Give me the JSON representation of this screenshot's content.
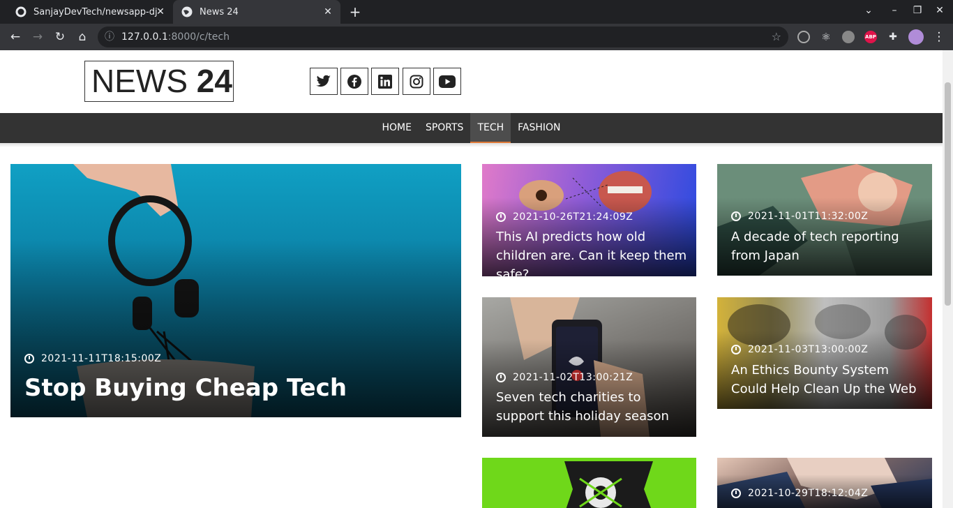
{
  "browser": {
    "tabs": [
      {
        "title": "SanjayDevTech/newsapp-djan",
        "favicon": "github-icon"
      },
      {
        "title": "News 24",
        "favicon": "globe-icon"
      }
    ],
    "url_host": "127.0.0.1",
    "url_path": ":8000/c/tech",
    "extensions": [
      "radio-icon",
      "react-icon",
      "gecko-icon",
      "abp-icon",
      "puzzle-icon",
      "avatar-icon"
    ],
    "abp_label": "ABP"
  },
  "site": {
    "logo_light": "NEWS ",
    "logo_bold": "24",
    "social": [
      "twitter-icon",
      "facebook-icon",
      "linkedin-icon",
      "instagram-icon",
      "youtube-icon"
    ],
    "nav": [
      {
        "label": "HOME",
        "active": false
      },
      {
        "label": "SPORTS",
        "active": false
      },
      {
        "label": "TECH",
        "active": true
      },
      {
        "label": "FASHION",
        "active": false
      }
    ]
  },
  "articles": {
    "featured": {
      "date": "2021-11-11T18:15:00Z",
      "title": "Stop Buying Cheap Tech"
    },
    "items": [
      {
        "date": "2021-10-26T21:24:09Z",
        "title": "This AI predicts how old children are. Can it keep them safe?"
      },
      {
        "date": "2021-11-01T11:32:00Z",
        "title": "A decade of tech reporting from Japan"
      },
      {
        "date": "2021-11-02T13:00:21Z",
        "title": "Seven tech charities to support this holiday season"
      },
      {
        "date": "2021-11-03T13:00:00Z",
        "title": "An Ethics Bounty System Could Help Clean Up the Web"
      },
      {
        "date": "",
        "title": ""
      },
      {
        "date": "2021-10-29T18:12:04Z",
        "title": ""
      }
    ]
  },
  "colors": {
    "nav_bg": "#333333",
    "active_underline": "#e07b39"
  }
}
